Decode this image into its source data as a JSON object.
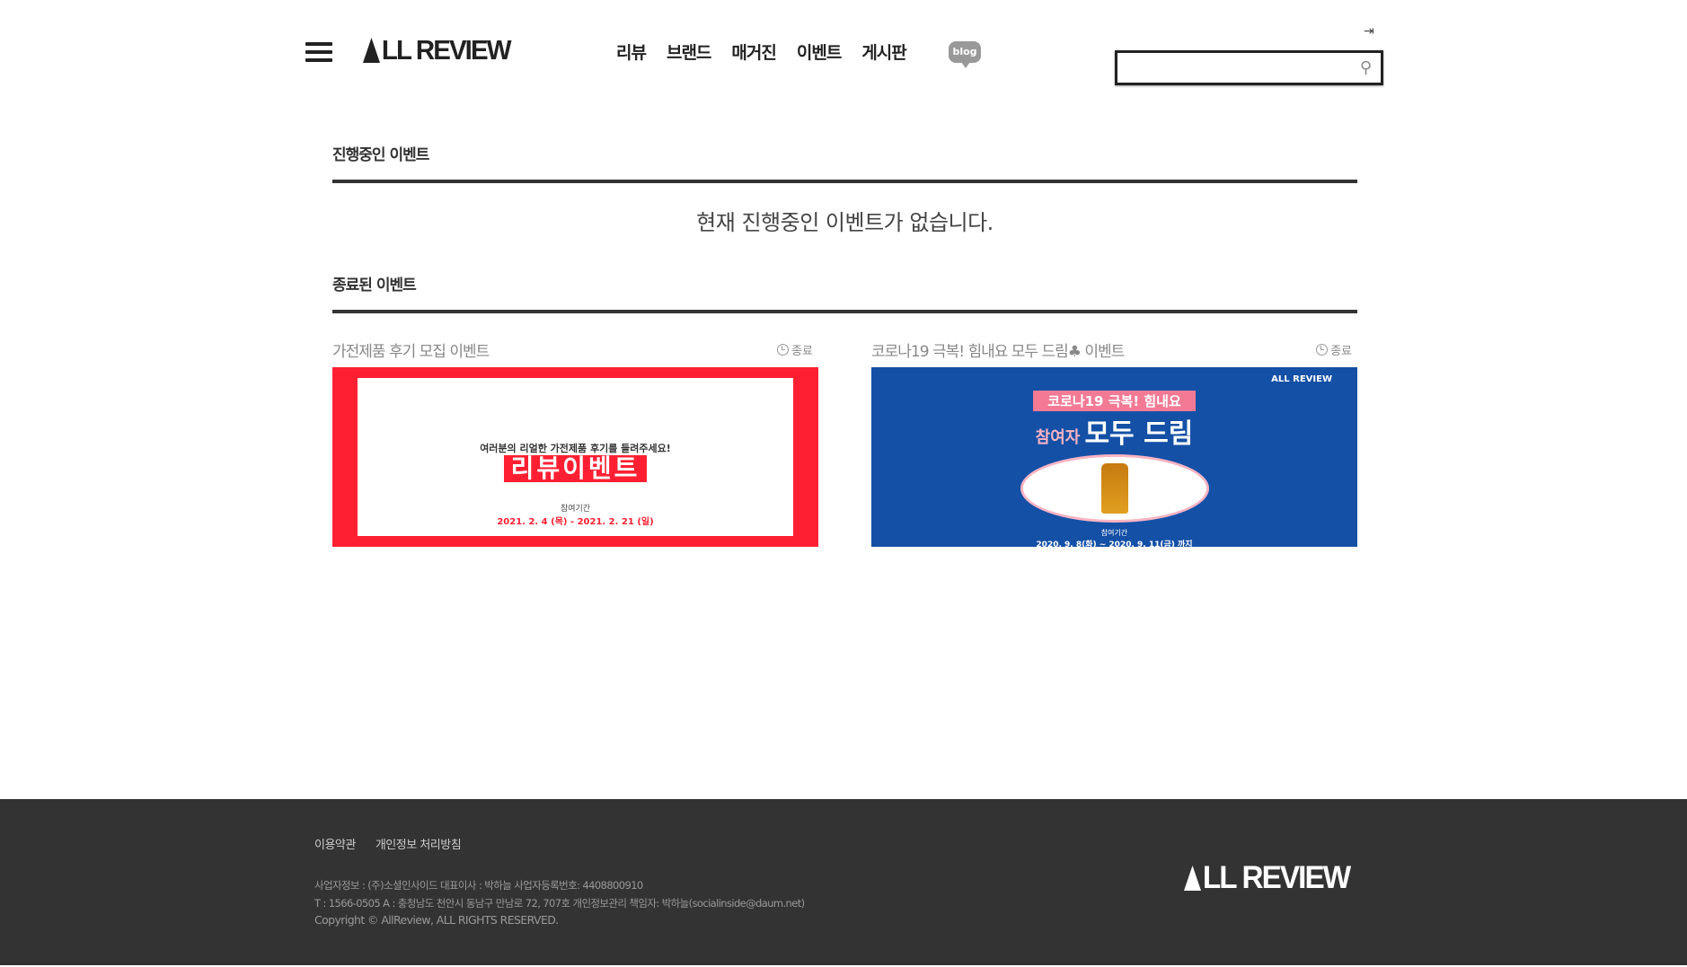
{
  "header": {
    "menu_icon": "hamburger-icon",
    "logo": "ALL REVIEW",
    "nav": [
      "리뷰",
      "브랜드",
      "매거진",
      "이벤트",
      "게시판"
    ],
    "blog_label": "blog",
    "login_icon": "login-icon",
    "search": {
      "value": "",
      "placeholder": "",
      "icon": "search-icon"
    }
  },
  "ongoing": {
    "title": "진행중인 이벤트",
    "empty_message": "현재 진행중인 이벤트가 없습니다."
  },
  "ended": {
    "title": "종료된 이벤트",
    "events": [
      {
        "title": "가전제품 후기 모집 이벤트",
        "status": "종료",
        "image": {
          "headline": "여러분의 리얼한 가전제품 후기를 들려주세요!",
          "banner": "리뷰이벤트",
          "period_label": "참여기간",
          "period": "2021. 2. 4 (목) - 2021. 2. 21 (일)"
        }
      },
      {
        "title": "코로나19 극복! 힘내요 모두 드림♣ 이벤트",
        "status": "종료",
        "image": {
          "brand": "ALL REVIEW",
          "ribbon": "코로나19 극복! 힘내요",
          "pre": "참여자",
          "banner": "모두 드림",
          "period_label": "참여기간",
          "period": "2020. 9. 8(화) ~ 2020. 9. 11(금) 까지"
        }
      }
    ]
  },
  "footer": {
    "links": [
      "이용약관",
      "개인정보 처리방침"
    ],
    "info": [
      "사업자정보 : (주)소셜인사이드 대표이사 : 박하늘 사업자등록번호: 4408800910",
      "T : 1566-0505 A : 충청남도 천안시 동남구 만남로 72, 707호 개인정보관리 책임자: 박하늘(socialinside@daum.net)",
      "Copyright © AllReview,    ALL RIGHTS RESERVED."
    ],
    "logo": "ALL REVIEW"
  },
  "colors": {
    "event1_bg": "#fe2032",
    "event2_bg": "#1450a6",
    "footer_bg": "#333333"
  }
}
